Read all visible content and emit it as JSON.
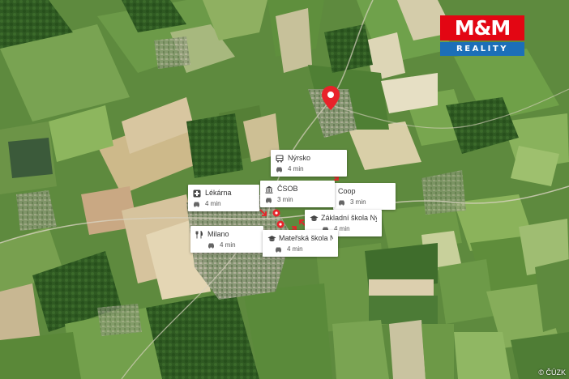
{
  "logo": {
    "brand": "M&M",
    "subtitle": "REALITY"
  },
  "copyright": "© ČÚZK",
  "pois": [
    {
      "id": "nyrsko",
      "name": "Nýrsko",
      "time": "4 min",
      "icon": "bus-icon"
    },
    {
      "id": "lekarna",
      "name": "Lékárna",
      "time": "4 min",
      "icon": "pharmacy-cross-icon"
    },
    {
      "id": "csob",
      "name": "ČSOB",
      "time": "3 min",
      "icon": "bank-icon"
    },
    {
      "id": "coop",
      "name": "Coop",
      "time": "3 min",
      "icon": "shop-icon"
    },
    {
      "id": "zakladni-skola",
      "name": "Základní škola Ný…",
      "time": "4 min",
      "icon": "school-icon"
    },
    {
      "id": "milano",
      "name": "Milano",
      "time": "4 min",
      "icon": "restaurant-icon"
    },
    {
      "id": "materska-skola",
      "name": "Mateřská škola N…",
      "time": "4 min",
      "icon": "school-icon"
    }
  ],
  "colors": {
    "pin": "#e8232a",
    "brand_red": "#e30613",
    "brand_blue": "#1c6fb8"
  }
}
